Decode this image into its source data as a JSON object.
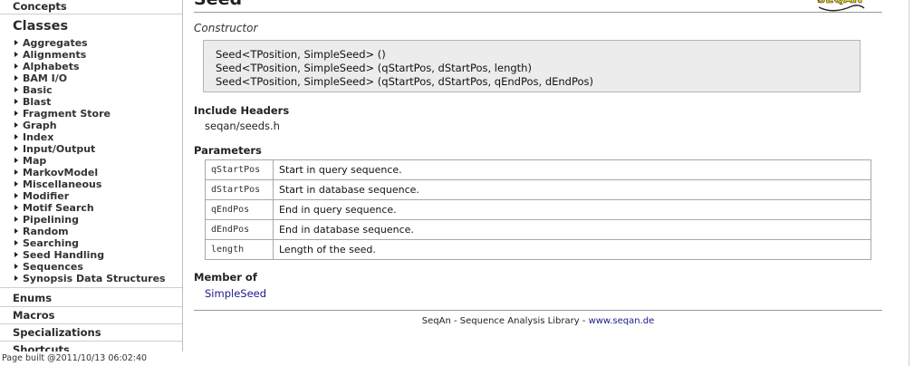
{
  "sidebar": {
    "concepts": "Concepts",
    "classes": "Classes",
    "class_items": [
      "Aggregates",
      "Alignments",
      "Alphabets",
      "BAM I/O",
      "Basic",
      "Blast",
      "Fragment Store",
      "Graph",
      "Index",
      "Input/Output",
      "Map",
      "MarkovModel",
      "Miscellaneous",
      "Modifier",
      "Motif Search",
      "Pipelining",
      "Random",
      "Searching",
      "Seed Handling",
      "Sequences",
      "Synopsis Data Structures"
    ],
    "enums": "Enums",
    "macros": "Macros",
    "specializations": "Specializations",
    "shortcuts": "Shortcuts"
  },
  "page_built": "Page built @2011/10/13 06:02:40",
  "main": {
    "title": "Seed",
    "constructor_label": "Constructor",
    "signatures": [
      "Seed<TPosition, SimpleSeed> ()",
      "Seed<TPosition, SimpleSeed> (qStartPos, dStartPos, length)",
      "Seed<TPosition, SimpleSeed> (qStartPos, dStartPos, qEndPos, dEndPos)"
    ],
    "include_headers_label": "Include Headers",
    "include_header": "seqan/seeds.h",
    "parameters_label": "Parameters",
    "parameters": [
      {
        "name": "qStartPos",
        "desc": "Start in query sequence."
      },
      {
        "name": "dStartPos",
        "desc": "Start in database sequence."
      },
      {
        "name": "qEndPos",
        "desc": "End in query sequence."
      },
      {
        "name": "dEndPos",
        "desc": "End in database sequence."
      },
      {
        "name": "length",
        "desc": "Length of the seed."
      }
    ],
    "member_of_label": "Member of",
    "member_of": "SimpleSeed",
    "footer_text": "SeqAn - Sequence Analysis Library - ",
    "footer_link": "www.seqan.de"
  },
  "colors": {
    "link": "#1a1a8c",
    "code_bg": "#ececec",
    "logo_yellow": "#f2d400"
  }
}
